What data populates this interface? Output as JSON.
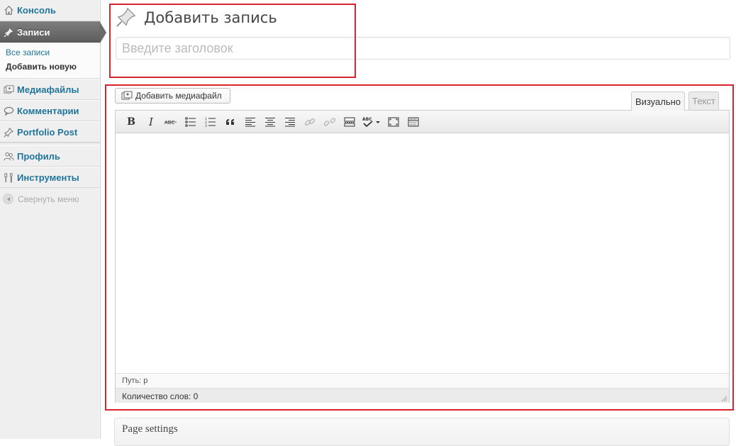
{
  "sidebar": {
    "items": [
      {
        "label": "Консоль",
        "icon": "home-icon"
      },
      {
        "label": "Записи",
        "icon": "pin-icon",
        "current": true
      },
      {
        "label": "Медиафайлы",
        "icon": "media-icon"
      },
      {
        "label": "Комментарии",
        "icon": "comment-icon"
      },
      {
        "label": "Portfolio Post",
        "icon": "pin-icon"
      },
      {
        "label": "Профиль",
        "icon": "users-icon"
      },
      {
        "label": "Инструменты",
        "icon": "tools-icon"
      }
    ],
    "submenu": [
      {
        "label": "Все записи"
      },
      {
        "label": "Добавить новую",
        "current": true
      }
    ],
    "collapse_label": "Свернуть меню"
  },
  "main": {
    "page_title": "Добавить запись",
    "title_placeholder": "Введите заголовок",
    "add_media_label": "Добавить медиафайл",
    "tabs": [
      {
        "label": "Визуально",
        "active": true
      },
      {
        "label": "Текст",
        "active": false
      }
    ],
    "toolbar": {
      "bold": "B",
      "italic": "I",
      "strikethrough": "ABC",
      "spellcheck": "ABC"
    },
    "status_path": "Путь: p",
    "word_count": "Количество слов: 0",
    "page_settings_title": "Page settings"
  },
  "colors": {
    "accent_link": "#21759b",
    "highlight_box": "#d9232e",
    "current_menu": "#6a6a6a"
  }
}
